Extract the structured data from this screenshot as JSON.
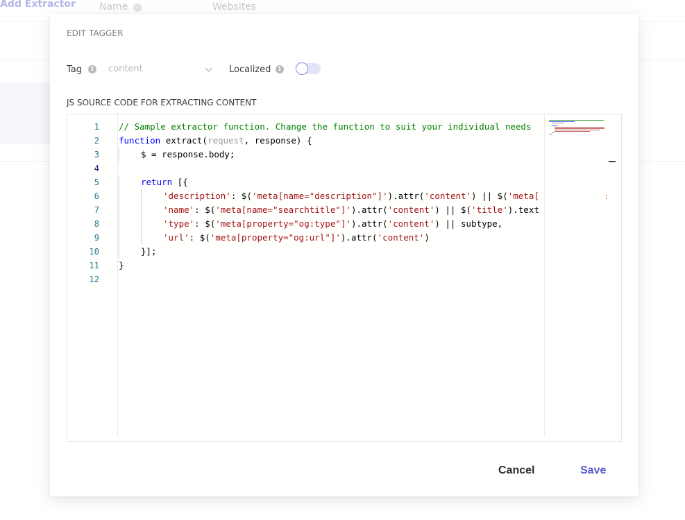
{
  "background": {
    "add_extractor_label": "Add Extractor",
    "columns": [
      "Name",
      "Websites"
    ],
    "info_glyph": "i"
  },
  "modal": {
    "title": "EDIT TAGGER",
    "tag": {
      "label": "Tag",
      "selected_value": "content"
    },
    "localized": {
      "label": "Localized",
      "enabled": false
    },
    "code_section_label": "JS SOURCE CODE FOR EXTRACTING CONTENT",
    "editor": {
      "active_line": 4,
      "line_numbers": [
        "1",
        "2",
        "3",
        "4",
        "5",
        "6",
        "7",
        "8",
        "9",
        "10",
        "11",
        "12"
      ],
      "lines": [
        "// Sample extractor function. Change the function to suit your individual needs",
        "function extract(request, response) {",
        "    $ = response.body;",
        "",
        "    return [{",
        "        'description': $('meta[name=\"description\"]').attr('content') || $('meta[",
        "        'name': $('meta[name=\"searchtitle\"]').attr('content') || $('title').text",
        "        'type': $('meta[property=\"og:type\"]').attr('content') || subtype,",
        "        'url': $('meta[property=\"og:url\"]').attr('content')",
        "    }];",
        "}",
        ""
      ]
    },
    "buttons": {
      "cancel": "Cancel",
      "save": "Save"
    }
  },
  "colors": {
    "accent": "#5457c8",
    "comment": "#008000",
    "keyword": "#0000ff",
    "string": "#a31515",
    "line_number": "#237893"
  }
}
